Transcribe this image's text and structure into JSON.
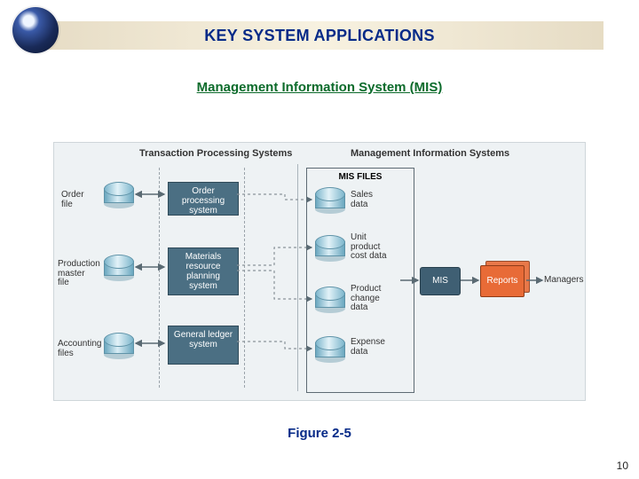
{
  "header": {
    "title": "KEY SYSTEM APPLICATIONS",
    "subtitle": "Management Information System (MIS)"
  },
  "diagram": {
    "section_tps": "Transaction Processing Systems",
    "section_mis": "Management Information Systems",
    "inputs": [
      {
        "label": "Order\nfile"
      },
      {
        "label": "Production\nmaster\nfile"
      },
      {
        "label": "Accounting\nfiles"
      }
    ],
    "processing": [
      {
        "label": "Order processing system"
      },
      {
        "label": "Materials resource planning system"
      },
      {
        "label": "General ledger system"
      }
    ],
    "misfiles_title": "MIS FILES",
    "misfiles": [
      {
        "label": "Sales\ndata"
      },
      {
        "label": "Unit\nproduct\ncost data"
      },
      {
        "label": "Product\nchange\ndata"
      },
      {
        "label": "Expense\ndata"
      }
    ],
    "mis_box": "MIS",
    "reports": "Reports",
    "managers": "Managers"
  },
  "caption": "Figure 2-5",
  "page": "10",
  "colors": {
    "title": "#062a88",
    "subtitle": "#0c6b2b",
    "proc_box": "#4b6f83",
    "report": "#e86b37"
  }
}
